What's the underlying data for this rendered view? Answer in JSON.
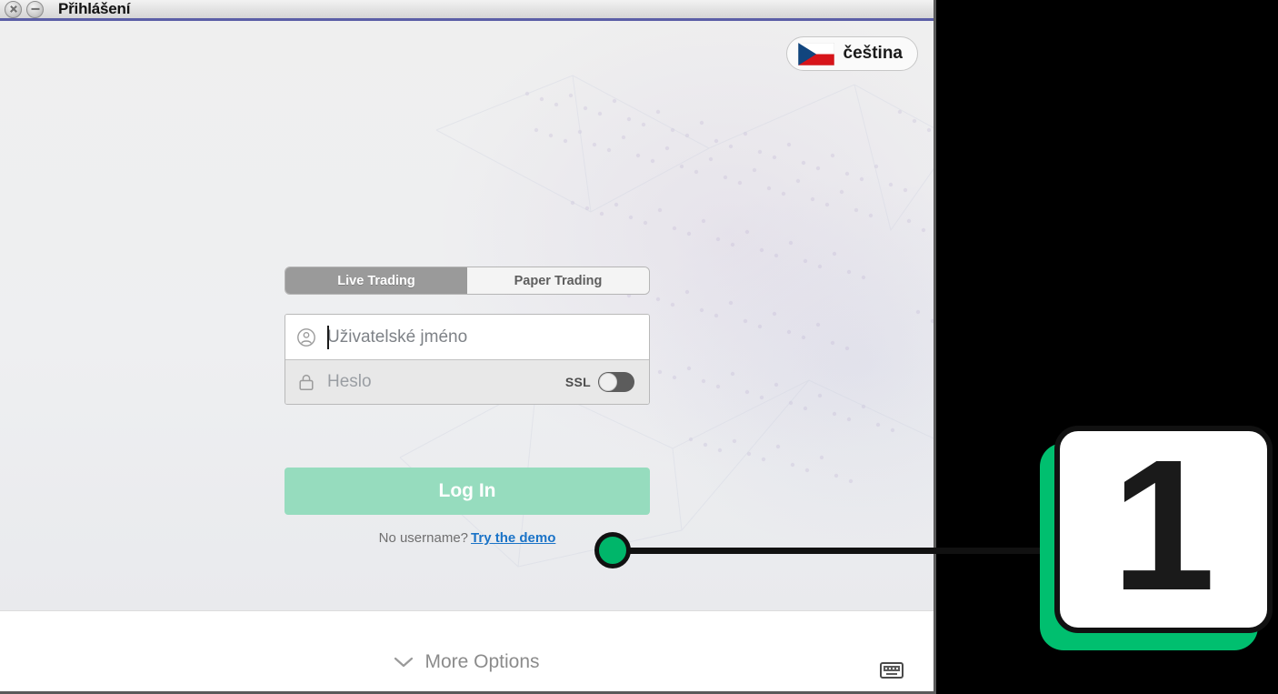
{
  "window": {
    "title": "Přihlášení",
    "close_icon": "close-icon",
    "minimize_icon": "minimize-icon"
  },
  "language_selector": {
    "label": "čeština",
    "flag": "czech-flag-icon"
  },
  "tabs": [
    {
      "label": "Live Trading",
      "active": true
    },
    {
      "label": "Paper Trading",
      "active": false
    }
  ],
  "form": {
    "username": {
      "placeholder": "Uživatelské jméno",
      "value": "",
      "icon": "user-icon",
      "focused": true
    },
    "password": {
      "placeholder": "Heslo",
      "value": "",
      "icon": "lock-icon"
    },
    "ssl": {
      "label": "SSL",
      "state": "off"
    },
    "login_button": "Log In",
    "demo_prompt": "No username?",
    "demo_link": "Try the demo"
  },
  "footer": {
    "more_options": "More Options",
    "chevron_icon": "chevron-down-icon",
    "keyboard_icon": "keyboard-icon"
  },
  "annotation": {
    "number": "1"
  },
  "colors": {
    "accent_green": "#00bf6f",
    "login_button": "#96dcbe",
    "link_blue": "#1a73c7",
    "title_underline": "#5b5ea6",
    "active_tab": "#9a9a9a"
  }
}
